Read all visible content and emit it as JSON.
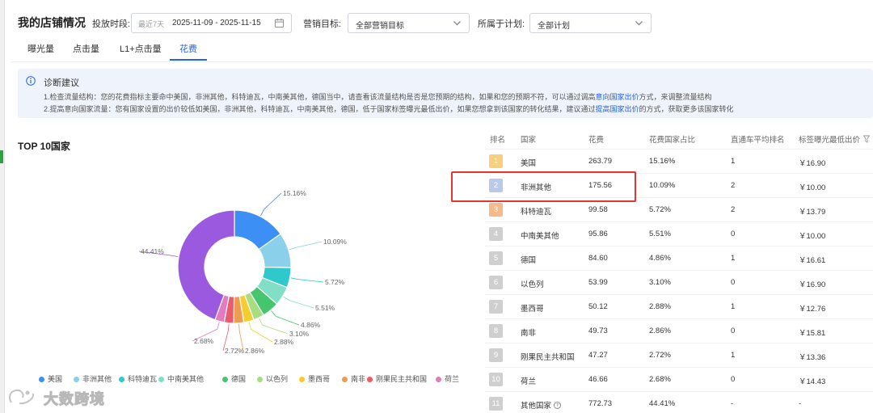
{
  "header": {
    "title": "我的店铺情况",
    "period_label": "投放时段:",
    "date_preset": "最近7天",
    "date_range": "2025-11-09 - 2025-11-15",
    "target_label": "营销目标:",
    "target_value": "全部营销目标",
    "plan_label": "所属于计划:",
    "plan_value": "全部计划"
  },
  "tabs": [
    {
      "label": "曝光量",
      "active": false
    },
    {
      "label": "点击量",
      "active": false
    },
    {
      "label": "L1+点击量",
      "active": false
    },
    {
      "label": "花费",
      "active": true
    }
  ],
  "diagnosis": {
    "title": "诊断建议",
    "line1_prefix": "1.检查流量结构：您的花费指标主要命中美国，非洲其他，科特迪瓦，中南美其他，德国当中，请查看该流量结构是否是您预期的结构，如果和您的预期不符，可以通过调高",
    "line1_link": "意向国家出价",
    "line1_suffix": "方式，来调整流量结构",
    "line2_prefix": "2.提高意向国家流量：您有国家设置的出价较低如美国，非洲其他，科特迪瓦，中南美其他，德国，低于国家标签曝光最低出价，如果您想拿到该国家的转化结果，建议通过",
    "line2_link": "提高国家出价",
    "line2_suffix": "的方式，获取更多该国家转化"
  },
  "chart_data": {
    "type": "pie",
    "title": "TOP 10国家",
    "donut": true,
    "categories": [
      "美国",
      "非洲其他",
      "科特迪瓦",
      "中南美其他",
      "德国",
      "以色列",
      "墨西哥",
      "南非",
      "刚果民主共和国",
      "荷兰",
      "其他国家"
    ],
    "values": [
      15.16,
      10.09,
      5.72,
      5.51,
      4.86,
      3.1,
      2.88,
      2.86,
      2.72,
      2.68,
      44.41
    ],
    "labels": [
      "15.16%",
      "10.09%",
      "5.72%",
      "5.51%",
      "4.86%",
      "3.10%",
      "2.88%",
      "2.86%",
      "2.72%",
      "2.68%",
      "44.41%"
    ],
    "colors": [
      "#3b8ff5",
      "#8ad0ea",
      "#2fc9cb",
      "#80dfc4",
      "#45c66d",
      "#a9dd82",
      "#f6cd2e",
      "#ee9c4f",
      "#ea5b6b",
      "#e47ac0",
      "#9b59e0"
    ],
    "legend_visible": [
      "美国",
      "非洲其他",
      "科特迪瓦",
      "中南美其他",
      "德国",
      "以色列",
      "墨西哥",
      "南非",
      "刚果民主共和国",
      "荷兰"
    ],
    "legend_position": "bottom"
  },
  "table": {
    "headers": [
      "排名",
      "国家",
      "花费",
      "花费国家占比",
      "直通车平均排名",
      "标签曝光最低出价"
    ],
    "rows": [
      {
        "rank": "1",
        "country": "美国",
        "spend": "263.79",
        "share": "15.16%",
        "avg_rank": "1",
        "min_bid": "￥16.90",
        "rank_color": "#f7cf7e"
      },
      {
        "rank": "2",
        "country": "非洲其他",
        "spend": "175.56",
        "share": "10.09%",
        "avg_rank": "2",
        "min_bid": "￥10.00",
        "rank_color": "#b9c9ec"
      },
      {
        "rank": "3",
        "country": "科特迪瓦",
        "spend": "99.58",
        "share": "5.72%",
        "avg_rank": "2",
        "min_bid": "￥13.79",
        "rank_color": "#f6b98a"
      },
      {
        "rank": "4",
        "country": "中南美其他",
        "spend": "95.86",
        "share": "5.51%",
        "avg_rank": "0",
        "min_bid": "￥10.00",
        "rank_color": "#cfcfcf"
      },
      {
        "rank": "5",
        "country": "德国",
        "spend": "84.60",
        "share": "4.86%",
        "avg_rank": "1",
        "min_bid": "￥16.61",
        "rank_color": "#cfcfcf"
      },
      {
        "rank": "6",
        "country": "以色列",
        "spend": "53.99",
        "share": "3.10%",
        "avg_rank": "0",
        "min_bid": "￥16.90",
        "rank_color": "#cfcfcf"
      },
      {
        "rank": "7",
        "country": "墨西哥",
        "spend": "50.12",
        "share": "2.88%",
        "avg_rank": "1",
        "min_bid": "￥12.76",
        "rank_color": "#cfcfcf"
      },
      {
        "rank": "8",
        "country": "南非",
        "spend": "49.73",
        "share": "2.86%",
        "avg_rank": "0",
        "min_bid": "￥15.81",
        "rank_color": "#cfcfcf"
      },
      {
        "rank": "9",
        "country": "刚果民主共和国",
        "spend": "47.27",
        "share": "2.72%",
        "avg_rank": "1",
        "min_bid": "￥13.36",
        "rank_color": "#cfcfcf"
      },
      {
        "rank": "10",
        "country": "荷兰",
        "spend": "46.66",
        "share": "2.68%",
        "avg_rank": "0",
        "min_bid": "￥14.43",
        "rank_color": "#cfcfcf"
      },
      {
        "rank": "11",
        "country": "其他国家",
        "spend": "772.73",
        "share": "44.41%",
        "avg_rank": "-",
        "min_bid": "-",
        "rank_color": "#cfcfcf",
        "help": true
      }
    ]
  },
  "watermark": {
    "text": "大数跨境"
  },
  "colors": {
    "accent": "#2a62e6",
    "highlight": "#e2362e",
    "diag_bg": "#eef3fc"
  }
}
